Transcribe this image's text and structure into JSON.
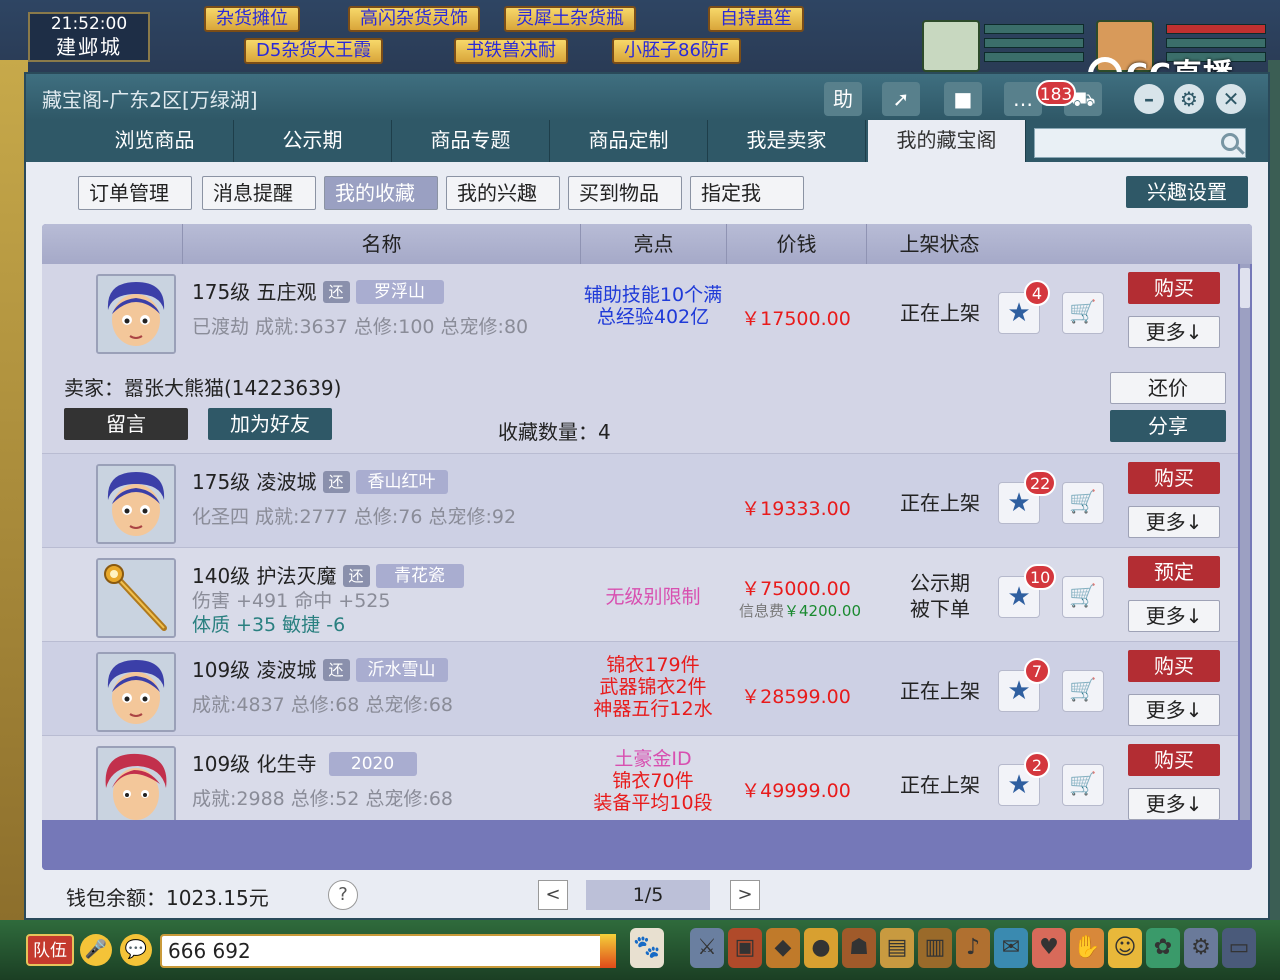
{
  "game": {
    "time": "21:52:00",
    "city": "建邺城",
    "stalls": [
      "杂货摊位",
      "高闪杂货灵饰",
      "灵犀土杂货瓶",
      "自持蛊笙",
      "D5杂货大王霞",
      "书铁兽决耐",
      "小胚子86防F"
    ],
    "cc_brand": "CC直播",
    "chat_input_value": "666  692",
    "team_label": "队伍"
  },
  "window": {
    "title": "藏宝阁-广东2区[万绿湖]",
    "notification_count": "183",
    "toolbar_icons": [
      "help-icon",
      "share-arrow-icon",
      "stop-icon",
      "chat-icon",
      "cart-icon"
    ],
    "search_placeholder": ""
  },
  "nav": {
    "tabs": [
      "浏览商品",
      "公示期",
      "商品专题",
      "商品定制",
      "我是卖家",
      "我的藏宝阁"
    ],
    "active_index": 5
  },
  "subtabs": {
    "items": [
      "订单管理",
      "消息提醒",
      "我的收藏",
      "我的兴趣",
      "买到物品",
      "指定我"
    ],
    "active_index": 2,
    "interest_settings": "兴趣设置"
  },
  "table": {
    "headers": [
      "名称",
      "亮点",
      "价钱",
      "上架状态"
    ],
    "rows": [
      {
        "name": "175级 五庄观",
        "badge": "还",
        "server": "罗浮山",
        "stats": "已渡劫 成就:3637 总修:100 总宠修:80",
        "stats2": "",
        "highlights": [
          "辅助技能10个满",
          "总经验402亿"
        ],
        "highlight_color": "blue",
        "price": "￥17500.00",
        "fee": "",
        "fee_value": "",
        "status": [
          "正在上架"
        ],
        "fav": "4",
        "action": "购买",
        "more": "更多↓",
        "avatar": "blue-hair"
      },
      {
        "name": "175级 凌波城",
        "badge": "还",
        "server": "香山红叶",
        "stats": "化圣四 成就:2777 总修:76 总宠修:92",
        "stats2": "",
        "highlights": [],
        "highlight_color": "red",
        "price": "￥19333.00",
        "fee": "",
        "fee_value": "",
        "status": [
          "正在上架"
        ],
        "fav": "22",
        "action": "购买",
        "more": "更多↓",
        "avatar": "blue-hair"
      },
      {
        "name": "140级 护法灭魔",
        "badge": "还",
        "server": "青花瓷",
        "stats": "伤害 +491 命中 +525",
        "stats2": "体质 +35 敏捷 -6",
        "highlights": [
          "无级别限制"
        ],
        "highlight_color": "pink",
        "price": "￥75000.00",
        "fee": "信息费",
        "fee_value": "￥4200.00",
        "status": [
          "公示期",
          "被下单"
        ],
        "fav": "10",
        "action": "预定",
        "more": "更多↓",
        "avatar": "weapon"
      },
      {
        "name": "109级 凌波城",
        "badge": "还",
        "server": "沂水雪山",
        "stats": "成就:4837 总修:68 总宠修:68",
        "stats2": "",
        "highlights": [
          "锦衣179件",
          "武器锦衣2件",
          "神器五行12水"
        ],
        "highlight_color": "red",
        "price": "￥28599.00",
        "fee": "",
        "fee_value": "",
        "status": [
          "正在上架"
        ],
        "fav": "7",
        "action": "购买",
        "more": "更多↓",
        "avatar": "blue-hair"
      },
      {
        "name": "109级 化生寺",
        "badge": "",
        "server": "2020",
        "stats": "成就:2988 总修:52 总宠修:68",
        "stats2": "",
        "highlights": [
          "土豪金ID",
          "锦衣70件",
          "装备平均10段"
        ],
        "highlight_color": "mixed",
        "price": "￥49999.00",
        "fee": "",
        "fee_value": "",
        "status": [
          "正在上架"
        ],
        "fav": "2",
        "action": "购买",
        "more": "更多↓",
        "avatar": "red-hair"
      }
    ],
    "expanded": {
      "seller": "卖家：嚣张大熊猫(14223639)",
      "message_btn": "留言",
      "add_friend_btn": "加为好友",
      "fav_count_label": "收藏数量：4",
      "counter_offer_btn": "还价",
      "share_btn": "分享"
    }
  },
  "footer": {
    "wallet": "钱包余额：1023.15元",
    "help": "?",
    "prev": "<",
    "next": ">",
    "page": "1/5"
  },
  "colors": {
    "window_bar": "#2f5867",
    "table_header": "#b8bcd6",
    "buy_red": "#b32d33",
    "price_red": "#e81b1b"
  }
}
